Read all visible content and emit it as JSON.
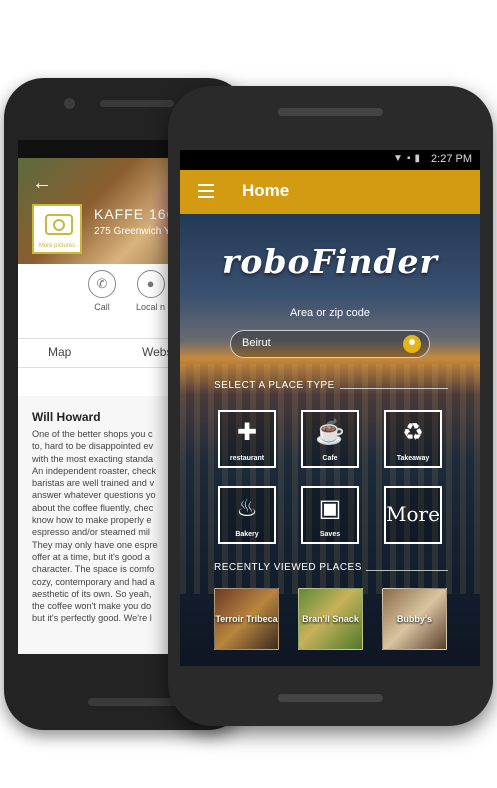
{
  "back_phone": {
    "back_icon": "arrow-left-icon",
    "shop_title": "KAFFE 1668",
    "shop_address": "275 Greenwich York",
    "more_pictures": "More pictures",
    "actions": [
      {
        "label": "Call",
        "icon": "phone-icon"
      },
      {
        "label": "Local n",
        "icon": "location-icon"
      }
    ],
    "tabs": [
      "Map",
      "Webs"
    ],
    "review": {
      "author": "Will Howard",
      "text": "One of the better shops you c\nto, hard to be disappointed ev\nwith the most exacting standa\nAn independent roaster, check\nbaristas are well trained and v\nanswer whatever questions yo\nabout the coffee fluently, chec\nknow how to make properly e\nespresso and/or  steamed mil\nThey may only have one espre\noffer at a time, but it's good a\ncharacter. The space is comfo\ncozy, contemporary and had a\naesthetic of its own. So yeah, \nthe coffee won't make you do\nbut it's perfectly good. We're l"
    }
  },
  "front_phone": {
    "status_time": "2:27 PM",
    "appbar_title": "Home",
    "logo_text": "roboFinder",
    "area_label": "Area or zip code",
    "search_value": "Beirut",
    "place_type_label": "SELECT A PLACE TYPE",
    "place_types": [
      {
        "label": "restaurant",
        "icon": "fork-knife-icon"
      },
      {
        "label": "Cafe",
        "icon": "coffee-cup-icon"
      },
      {
        "label": "Takeaway",
        "icon": "takeaway-cup-icon"
      },
      {
        "label": "Bakery",
        "icon": "muffin-icon"
      },
      {
        "label": "Saves",
        "icon": "save-disk-icon"
      },
      {
        "label": "More",
        "icon": "more-icon"
      }
    ],
    "recent_label": "RECENTLY VIEWED PLACES",
    "recent_places": [
      "Terroir Tribeca",
      "Bran'il Snack",
      "Bubby's"
    ],
    "accent_color": "#d29b12"
  }
}
